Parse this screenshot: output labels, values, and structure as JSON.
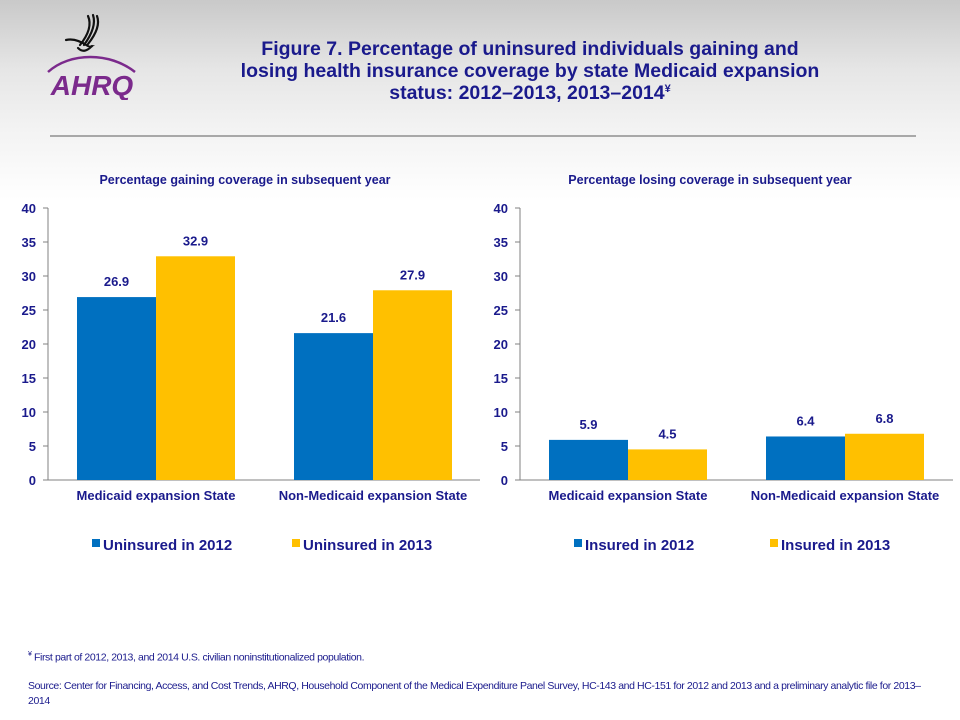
{
  "header": {
    "logo_text": "AHRQ",
    "title_main": "Figure 7. Percentage of uninsured individuals gaining and losing health insurance coverage by state Medicaid expansion status: 2012–2013, 2013–2014",
    "title_mark": "¥"
  },
  "colors": {
    "series1": "#0070c0",
    "series2": "#ffc000",
    "text": "#1a1a8c",
    "axis": "#808080"
  },
  "chart_data": [
    {
      "type": "bar",
      "title": "Percentage gaining coverage in subsequent year",
      "categories": [
        "Medicaid expansion State",
        "Non-Medicaid expansion State"
      ],
      "series": [
        {
          "name": "Uninsured in 2012",
          "values": [
            26.9,
            21.6
          ]
        },
        {
          "name": "Uninsured in 2013",
          "values": [
            32.9,
            27.9
          ]
        }
      ],
      "yticks": [
        "0",
        "5",
        "10",
        "15",
        "20",
        "25",
        "30",
        "35",
        "40"
      ],
      "ylim": [
        0,
        40
      ],
      "xlabel": "",
      "ylabel": "",
      "grid": false,
      "legend": "bottom"
    },
    {
      "type": "bar",
      "title": "Percentage losing coverage in subsequent year",
      "categories": [
        "Medicaid expansion State",
        "Non-Medicaid expansion State"
      ],
      "series": [
        {
          "name": "Insured in 2012",
          "values": [
            5.9,
            6.4
          ]
        },
        {
          "name": "Insured in 2013",
          "values": [
            4.5,
            6.8
          ]
        }
      ],
      "yticks": [
        "0",
        "5",
        "10",
        "15",
        "20",
        "25",
        "30",
        "35",
        "40"
      ],
      "ylim": [
        0,
        40
      ],
      "xlabel": "",
      "ylabel": "",
      "grid": false,
      "legend": "bottom"
    }
  ],
  "footer": {
    "footnote_mark": "¥",
    "footnote": " First part of 2012, 2013, and 2014 U.S. civilian noninstitutionalized population.",
    "source": "Source: Center for Financing, Access, and Cost Trends, AHRQ, Household Component of the Medical Expenditure Panel Survey, HC-143 and HC-151 for 2012 and 2013 and a preliminary analytic file for 2013–2014"
  }
}
